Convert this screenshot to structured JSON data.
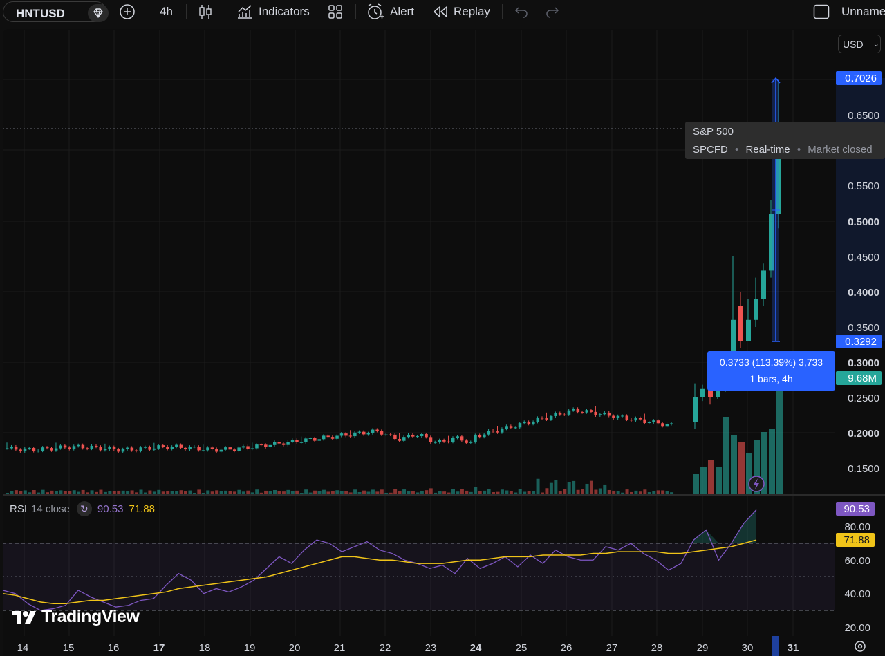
{
  "toolbar": {
    "symbol": "HNTUSD",
    "interval": "4h",
    "indicators_label": "Indicators",
    "alert_label": "Alert",
    "replay_label": "Replay",
    "layout_name": "Unname"
  },
  "chart": {
    "currency": "USD",
    "price_axis": [
      "0.6500",
      "0.5500",
      "0.5000",
      "0.4500",
      "0.4000",
      "0.3500",
      "0.3000",
      "0.2500",
      "0.2000",
      "0.1500"
    ],
    "time_axis": [
      "14",
      "15",
      "16",
      "17",
      "18",
      "19",
      "20",
      "21",
      "22",
      "23",
      "24",
      "25",
      "26",
      "27",
      "28",
      "29",
      "30",
      "31"
    ],
    "rsi_axis": [
      "80.00",
      "60.00",
      "40.00",
      "20.00"
    ],
    "price_tag_high": "0.7026",
    "price_tag_low": "0.3292",
    "volume_tag": "9.68M",
    "symbol_tooltip": {
      "name": "S&P 500",
      "ticker": "SPCFD",
      "realtime": "Real-time",
      "status": "Market closed"
    },
    "measure": {
      "line1": "0.3733 (113.39%) 3,733",
      "line2": "1 bars, 4h"
    },
    "rsi_legend": {
      "name": "RSI",
      "params": "14 close",
      "value_rsi": "90.53",
      "value_ma": "71.88"
    },
    "rsi_tag_rsi": "90.53",
    "rsi_tag_ma": "71.88",
    "logo_text": "TradingView",
    "colors": {
      "up": "#26a69a",
      "down": "#ef5350",
      "rsi": "#7e57c2",
      "rsi_ma": "#f0c419",
      "accent": "#2962ff"
    }
  }
}
